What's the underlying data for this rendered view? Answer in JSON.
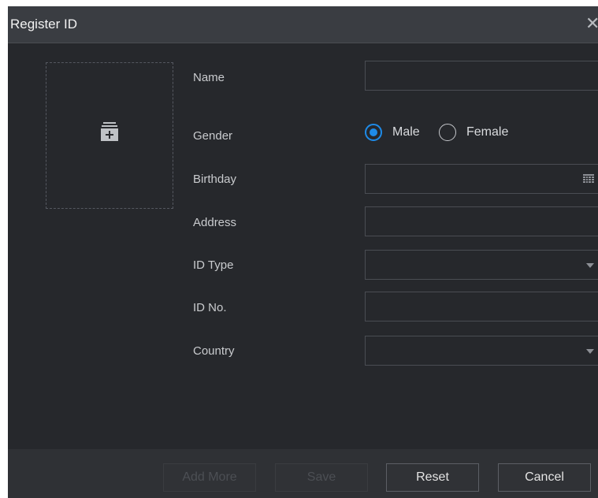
{
  "dialog": {
    "title": "Register ID"
  },
  "form": {
    "name": {
      "label": "Name",
      "value": ""
    },
    "gender": {
      "label": "Gender",
      "options": [
        {
          "label": "Male",
          "checked": true
        },
        {
          "label": "Female",
          "checked": false
        }
      ]
    },
    "birthday": {
      "label": "Birthday",
      "value": ""
    },
    "address": {
      "label": "Address",
      "value": ""
    },
    "id_type": {
      "label": "ID Type",
      "value": ""
    },
    "id_no": {
      "label": "ID No.",
      "value": ""
    },
    "country": {
      "label": "Country",
      "value": ""
    }
  },
  "footer": {
    "add_more_label": "Add More",
    "save_label": "Save",
    "reset_label": "Reset",
    "cancel_label": "Cancel"
  },
  "colors": {
    "accent": "#1e8be8",
    "background": "#26282c",
    "titlebar": "#3a3d42"
  },
  "icons": {
    "close": "close-icon",
    "photo": "add-photo-icon",
    "calendar": "calendar-icon",
    "dropdown": "chevron-down-icon"
  }
}
